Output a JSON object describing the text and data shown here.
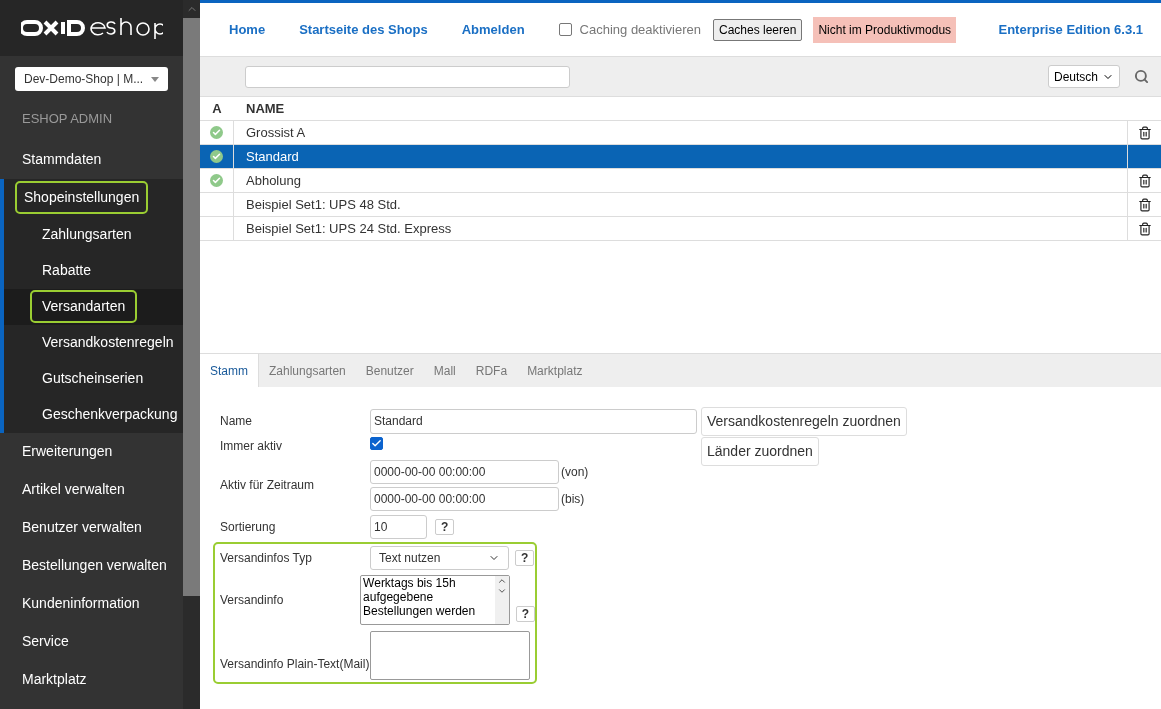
{
  "sidebar": {
    "shop_select": "Dev-Demo-Shop | M...",
    "heading": "ESHOP ADMIN",
    "items": [
      {
        "label": "Stammdaten",
        "expanded": false,
        "highlighted": false
      },
      {
        "label": "Shopeinstellungen",
        "expanded": true,
        "highlighted": true,
        "children": [
          {
            "label": "Zahlungsarten",
            "selected": false,
            "highlighted": false
          },
          {
            "label": "Rabatte",
            "selected": false,
            "highlighted": false
          },
          {
            "label": "Versandarten",
            "selected": true,
            "highlighted": true
          },
          {
            "label": "Versandkostenregeln",
            "selected": false,
            "highlighted": false
          },
          {
            "label": "Gutscheinserien",
            "selected": false,
            "highlighted": false
          },
          {
            "label": "Geschenkverpackung",
            "selected": false,
            "highlighted": false
          }
        ]
      },
      {
        "label": "Erweiterungen",
        "expanded": false,
        "highlighted": false
      },
      {
        "label": "Artikel verwalten",
        "expanded": false,
        "highlighted": false
      },
      {
        "label": "Benutzer verwalten",
        "expanded": false,
        "highlighted": false
      },
      {
        "label": "Bestellungen verwalten",
        "expanded": false,
        "highlighted": false
      },
      {
        "label": "Kundeninformation",
        "expanded": false,
        "highlighted": false
      },
      {
        "label": "Service",
        "expanded": false,
        "highlighted": false
      },
      {
        "label": "Marktplatz",
        "expanded": false,
        "highlighted": false
      }
    ]
  },
  "topbar": {
    "links": [
      "Home",
      "Startseite des Shops",
      "Abmelden"
    ],
    "caching": {
      "label": "Caching deaktivieren",
      "checked": false
    },
    "clear_button": "Caches leeren",
    "mode_badge": "Nicht im Produktivmodus",
    "edition": "Enterprise Edition 6.3.1"
  },
  "list": {
    "language": "Deutsch",
    "columns": [
      "A",
      "NAME"
    ],
    "rows": [
      {
        "name": "Grossist A",
        "active": true,
        "selected": false,
        "deletable": true
      },
      {
        "name": "Standard",
        "active": true,
        "selected": true,
        "deletable": false
      },
      {
        "name": "Abholung",
        "active": true,
        "selected": false,
        "deletable": true
      },
      {
        "name": "Beispiel Set1: UPS 48 Std.",
        "active": false,
        "selected": false,
        "deletable": true
      },
      {
        "name": "Beispiel Set1: UPS 24 Std. Express",
        "active": false,
        "selected": false,
        "deletable": true
      }
    ]
  },
  "tabs": [
    {
      "label": "Stamm",
      "selected": true
    },
    {
      "label": "Zahlungsarten",
      "selected": false
    },
    {
      "label": "Benutzer",
      "selected": false
    },
    {
      "label": "Mall",
      "selected": false
    },
    {
      "label": "RDFa",
      "selected": false
    },
    {
      "label": "Marktplatz",
      "selected": false
    }
  ],
  "form": {
    "name_label": "Name",
    "name_value": "Standard",
    "assign_buttons": [
      "Versandkostenregeln zuordnen",
      "Länder zuordnen"
    ],
    "always_active": {
      "label": "Immer aktiv",
      "checked": true
    },
    "period": {
      "label": "Aktiv für Zeitraum",
      "from": "0000-00-00 00:00:00",
      "from_suffix": "(von)",
      "to": "0000-00-00 00:00:00",
      "to_suffix": "(bis)"
    },
    "sort": {
      "label": "Sortierung",
      "value": "10",
      "help": "?"
    },
    "highlighted_group": true,
    "info_type": {
      "label": "Versandinfos Typ",
      "value": "Text nutzen",
      "help": "?"
    },
    "info": {
      "label": "Versandinfo",
      "value": "Werktags bis 15h\naufgegebene\nBestellungen werden",
      "help": "?"
    },
    "info_plain": {
      "label": "Versandinfo Plain-Text(Mail)"
    }
  }
}
